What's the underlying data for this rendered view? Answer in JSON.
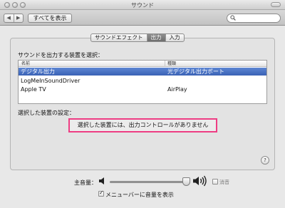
{
  "window": {
    "title": "サウンド"
  },
  "toolbar": {
    "back_glyph": "◀",
    "forward_glyph": "▶",
    "show_all_label": "すべてを表示",
    "search_icon": "search-icon"
  },
  "tabs": [
    {
      "label": "サウンドエフェクト",
      "active": false
    },
    {
      "label": "出力",
      "active": true
    },
    {
      "label": "入力",
      "active": false
    }
  ],
  "output": {
    "select_label": "サウンドを出力する装置を選択：",
    "columns": {
      "name": "名前",
      "type": "種類"
    },
    "devices": [
      {
        "name": "デジタル出力",
        "type": "光デジタル出力ポート",
        "selected": true
      },
      {
        "name": "LogMeInSoundDriver",
        "type": "",
        "selected": false
      },
      {
        "name": "Apple TV",
        "type": "AirPlay",
        "selected": false
      }
    ],
    "settings_label": "選択した装置の設定：",
    "no_controls_message": "選択した装置には、出力コントロールがありません",
    "highlight_color": "#ee3d83",
    "selection_color": "#3a62b5"
  },
  "help": {
    "glyph": "?"
  },
  "volume": {
    "label": "主音量：",
    "level": 0.95,
    "mute_label": "消音",
    "mute_checked": false
  },
  "menubar_volume": {
    "label": "メニューバーに音量を表示",
    "checked": true
  }
}
